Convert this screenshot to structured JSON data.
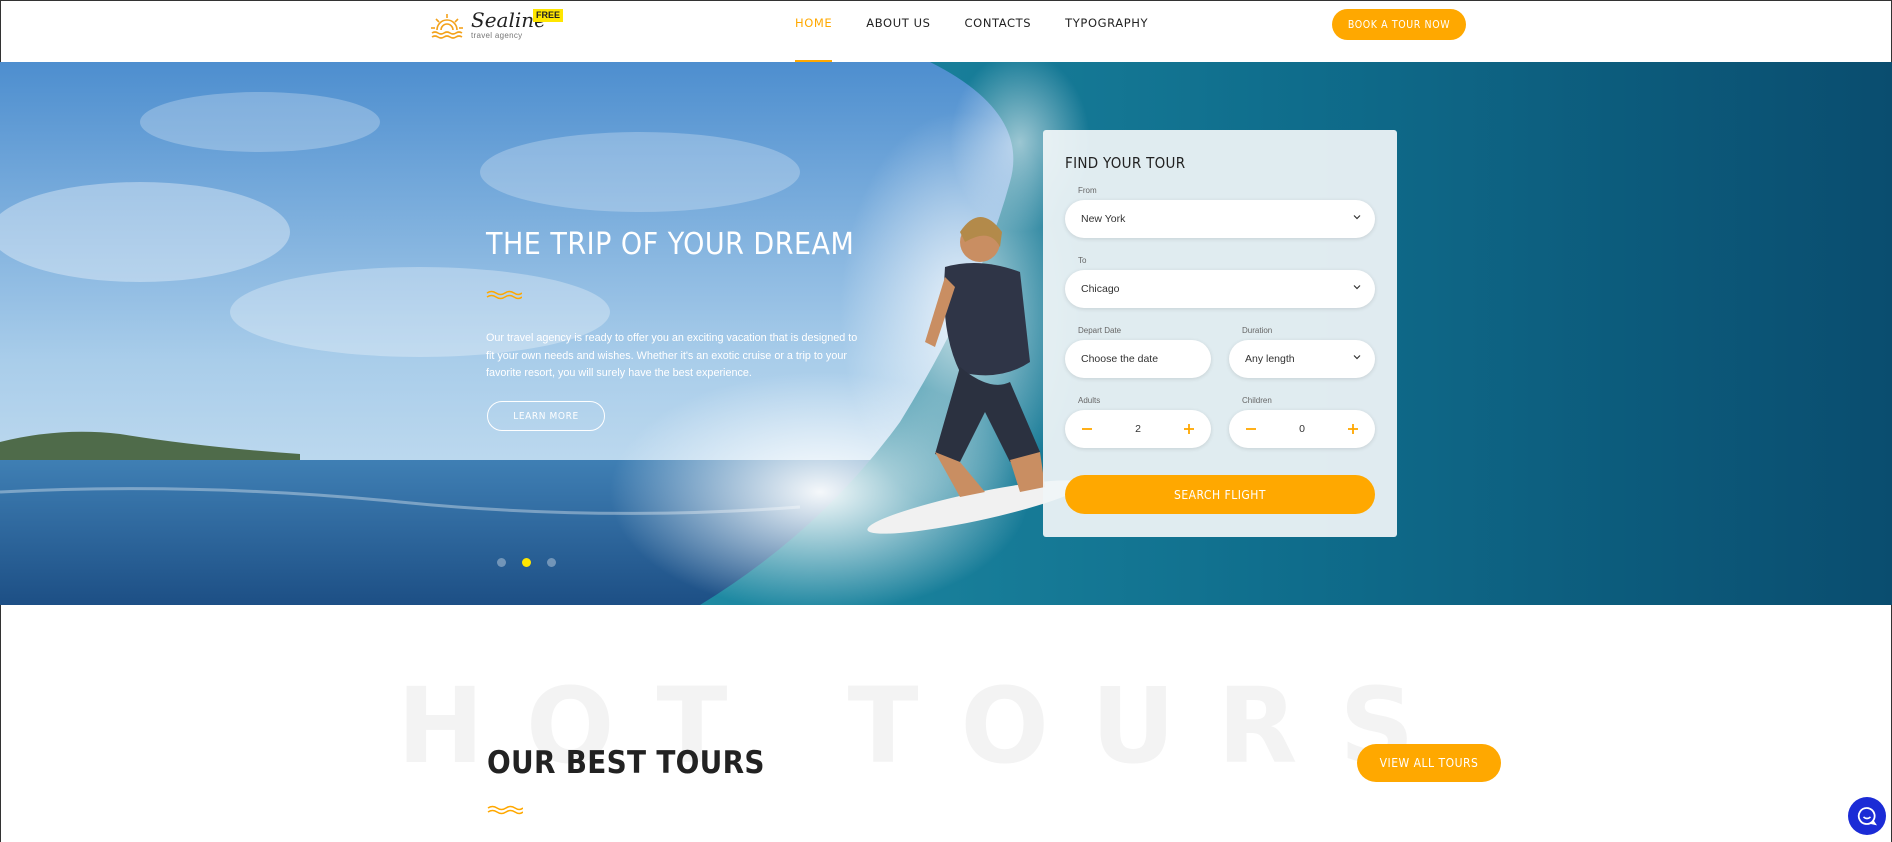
{
  "header": {
    "logo_name": "Sealine",
    "logo_sub": "travel agency",
    "logo_badge": "FREE",
    "nav": [
      {
        "label": "HOME",
        "active": true
      },
      {
        "label": "ABOUT US",
        "active": false
      },
      {
        "label": "CONTACTS",
        "active": false
      },
      {
        "label": "TYPOGRAPHY",
        "active": false
      }
    ],
    "book_label": "BOOK A TOUR NOW"
  },
  "hero": {
    "title": "THE TRIP OF YOUR DREAM",
    "text": "Our travel agency is ready to offer you an exciting vacation that is designed to fit your own needs and wishes. Whether it's an exotic cruise or a trip to your favorite resort, you will surely have the best experience.",
    "learn_more": "LEARN MORE",
    "slides": 3,
    "active_slide": 2
  },
  "search": {
    "title": "FIND YOUR TOUR",
    "from_label": "From",
    "from_value": "New York",
    "to_label": "To",
    "to_value": "Chicago",
    "depart_label": "Depart Date",
    "depart_placeholder": "Choose the date",
    "duration_label": "Duration",
    "duration_value": "Any length",
    "adults_label": "Adults",
    "adults_value": "2",
    "children_label": "Children",
    "children_value": "0",
    "submit_label": "SEARCH FLIGHT"
  },
  "section": {
    "bg_word": "HOT TOURS",
    "title": "OUR BEST TOURS",
    "view_all": "VIEW ALL TOURS"
  },
  "colors": {
    "accent": "#ffa800",
    "badge": "#ffe600",
    "chat": "#1b2bd6"
  },
  "icons": [
    "sun-logo-icon",
    "chevron-down-icon",
    "minus-icon",
    "plus-icon",
    "wave-divider-icon",
    "chat-icon"
  ]
}
